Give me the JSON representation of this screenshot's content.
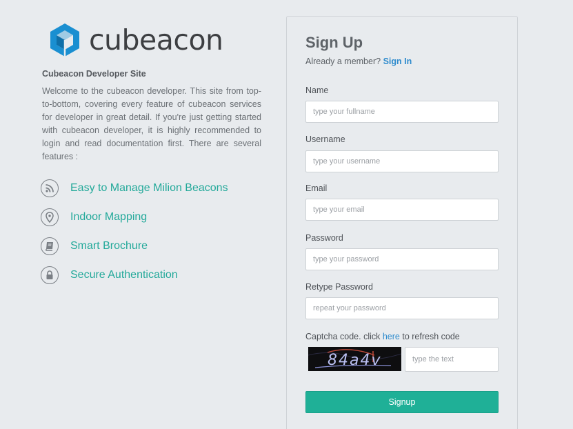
{
  "brand": {
    "name": "cubeacon",
    "logo_color": "#1a8fd1"
  },
  "intro": {
    "title": "Cubeacon Developer Site",
    "description": "Welcome to the cubeacon developer. This site from top-to-bottom, covering every feature of cubeacon services for developer in great detail. If you're just getting started with cubeacon developer, it is highly recommended to login and read documentation first. There are several features :"
  },
  "features": [
    {
      "icon": "rss-icon",
      "label": "Easy to Manage Milion Beacons"
    },
    {
      "icon": "map-pin-icon",
      "label": "Indoor Mapping"
    },
    {
      "icon": "book-icon",
      "label": "Smart Brochure"
    },
    {
      "icon": "lock-icon",
      "label": "Secure Authentication"
    }
  ],
  "signup": {
    "title": "Sign Up",
    "member_text": "Already a member?",
    "signin_link": "Sign In",
    "fields": {
      "name": {
        "label": "Name",
        "placeholder": "type your fullname",
        "value": ""
      },
      "username": {
        "label": "Username",
        "placeholder": "type your username",
        "value": ""
      },
      "email": {
        "label": "Email",
        "placeholder": "type your email",
        "value": ""
      },
      "password": {
        "label": "Password",
        "placeholder": "type your password",
        "value": ""
      },
      "retype": {
        "label": "Retype Password",
        "placeholder": "repeat your password",
        "value": ""
      }
    },
    "captcha": {
      "prefix": "Captcha code. click ",
      "link": "here",
      "suffix": " to refresh code",
      "image_text": "84a4v",
      "placeholder": "type the text",
      "value": ""
    },
    "submit_label": "Signup"
  },
  "colors": {
    "accent": "#1fb097",
    "link": "#2e8bcd",
    "feature_text": "#23a99a",
    "background": "#e8ebee"
  }
}
